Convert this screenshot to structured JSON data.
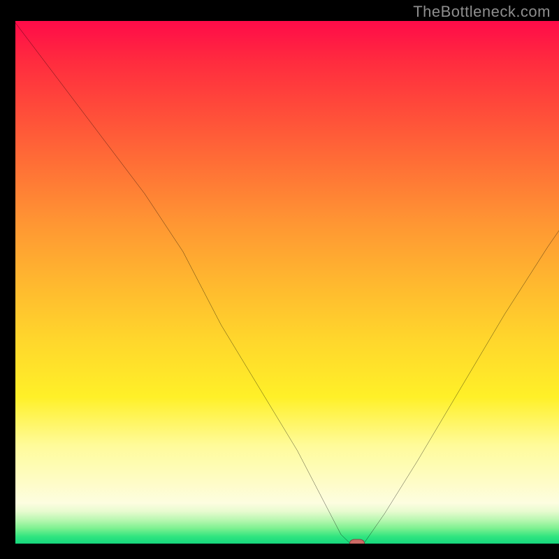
{
  "watermark": "TheBottleneck.com",
  "chart_data": {
    "type": "line",
    "title": "",
    "xlabel": "",
    "ylabel": "",
    "xlim": [
      0,
      100
    ],
    "ylim": [
      0,
      100
    ],
    "series": [
      {
        "name": "bottleneck-curve",
        "x": [
          0,
          8,
          16,
          24,
          31,
          38,
          45,
          52,
          57,
          60,
          62,
          64,
          68,
          74,
          82,
          90,
          98,
          100
        ],
        "values": [
          100,
          89,
          78,
          67,
          56,
          42,
          30,
          18,
          8,
          2,
          0,
          0,
          6,
          16,
          30,
          44,
          57,
          60
        ]
      }
    ],
    "marker": {
      "x": 63,
      "y": 0.2
    },
    "background_gradient_stops": [
      {
        "pos": 0.0,
        "color": "#ff0b49"
      },
      {
        "pos": 0.08,
        "color": "#ff2a3f"
      },
      {
        "pos": 0.18,
        "color": "#ff4a3a"
      },
      {
        "pos": 0.3,
        "color": "#ff7036"
      },
      {
        "pos": 0.42,
        "color": "#ff9633"
      },
      {
        "pos": 0.54,
        "color": "#ffb72f"
      },
      {
        "pos": 0.66,
        "color": "#ffd62c"
      },
      {
        "pos": 0.78,
        "color": "#fff028"
      },
      {
        "pos": 0.88,
        "color": "#fffb9a"
      },
      {
        "pos": 0.92,
        "color": "#fdfde0"
      },
      {
        "pos": 0.94,
        "color": "#b9f7b1"
      },
      {
        "pos": 0.97,
        "color": "#2fe57f"
      },
      {
        "pos": 1.0,
        "color": "#11d47e"
      }
    ]
  }
}
